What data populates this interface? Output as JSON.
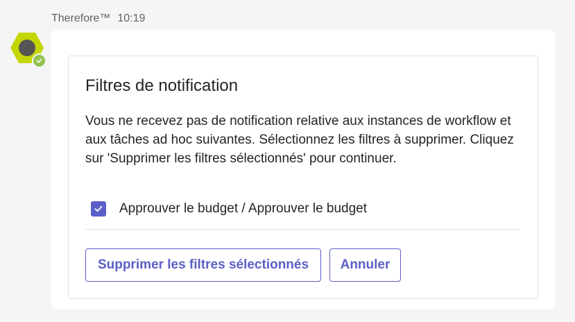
{
  "message": {
    "sender": "Therefore™",
    "time": "10:19"
  },
  "avatar": {
    "status": "available",
    "brand_color": "#c4d600",
    "status_color": "#92c353"
  },
  "card": {
    "title": "Filtres de notification",
    "description": "Vous ne recevez pas de notification relative aux instances de workflow et aux tâches ad hoc suivantes. Sélectionnez les filtres à supprimer. Cliquez sur 'Supprimer les filtres sélectionnés' pour continuer.",
    "filters": [
      {
        "label": "Approuver le budget / Approuver le budget",
        "checked": true
      }
    ],
    "actions": {
      "remove_label": "Supprimer les filtres sélectionnés",
      "cancel_label": "Annuler"
    }
  },
  "colors": {
    "accent": "#5b5fc7",
    "text": "#242424",
    "meta_text": "#616161",
    "background": "#f5f5f5"
  }
}
